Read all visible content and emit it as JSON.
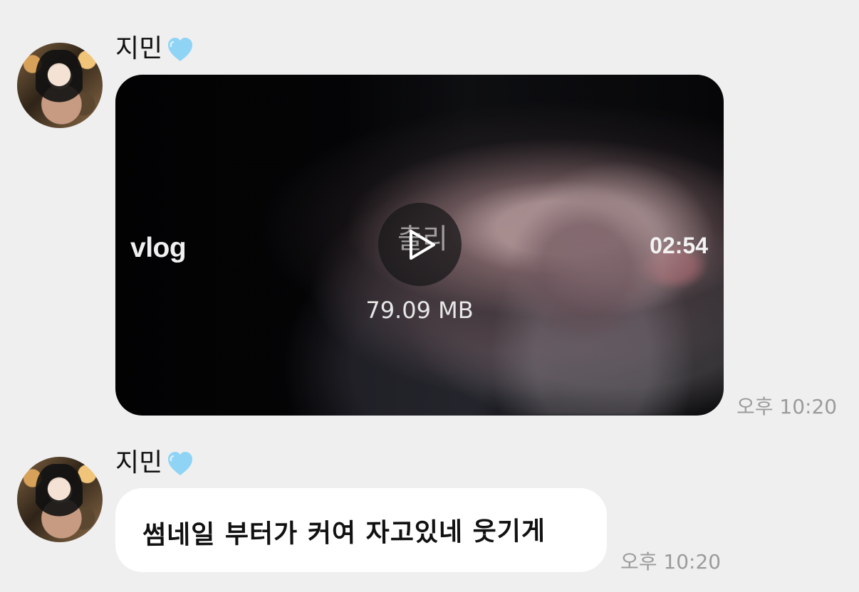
{
  "messages": [
    {
      "sender": "지민",
      "type": "video",
      "video": {
        "title": "vlog",
        "duration": "02:54",
        "size": "79.09 MB",
        "overlay_text": "출리"
      },
      "time": "오후 10:20"
    },
    {
      "sender": "지민",
      "type": "text",
      "text": "썸네일 부터가 커여 자고있네 웃기게",
      "time": "오후 10:20"
    }
  ],
  "icons": {
    "heart": "blue-heart-icon",
    "play": "play-icon",
    "avatar": "profile-avatar"
  },
  "colors": {
    "background": "#efeff0",
    "bubble": "#ffffff",
    "timestamp": "#9b9b9b",
    "heart": "#8fd3f5"
  }
}
